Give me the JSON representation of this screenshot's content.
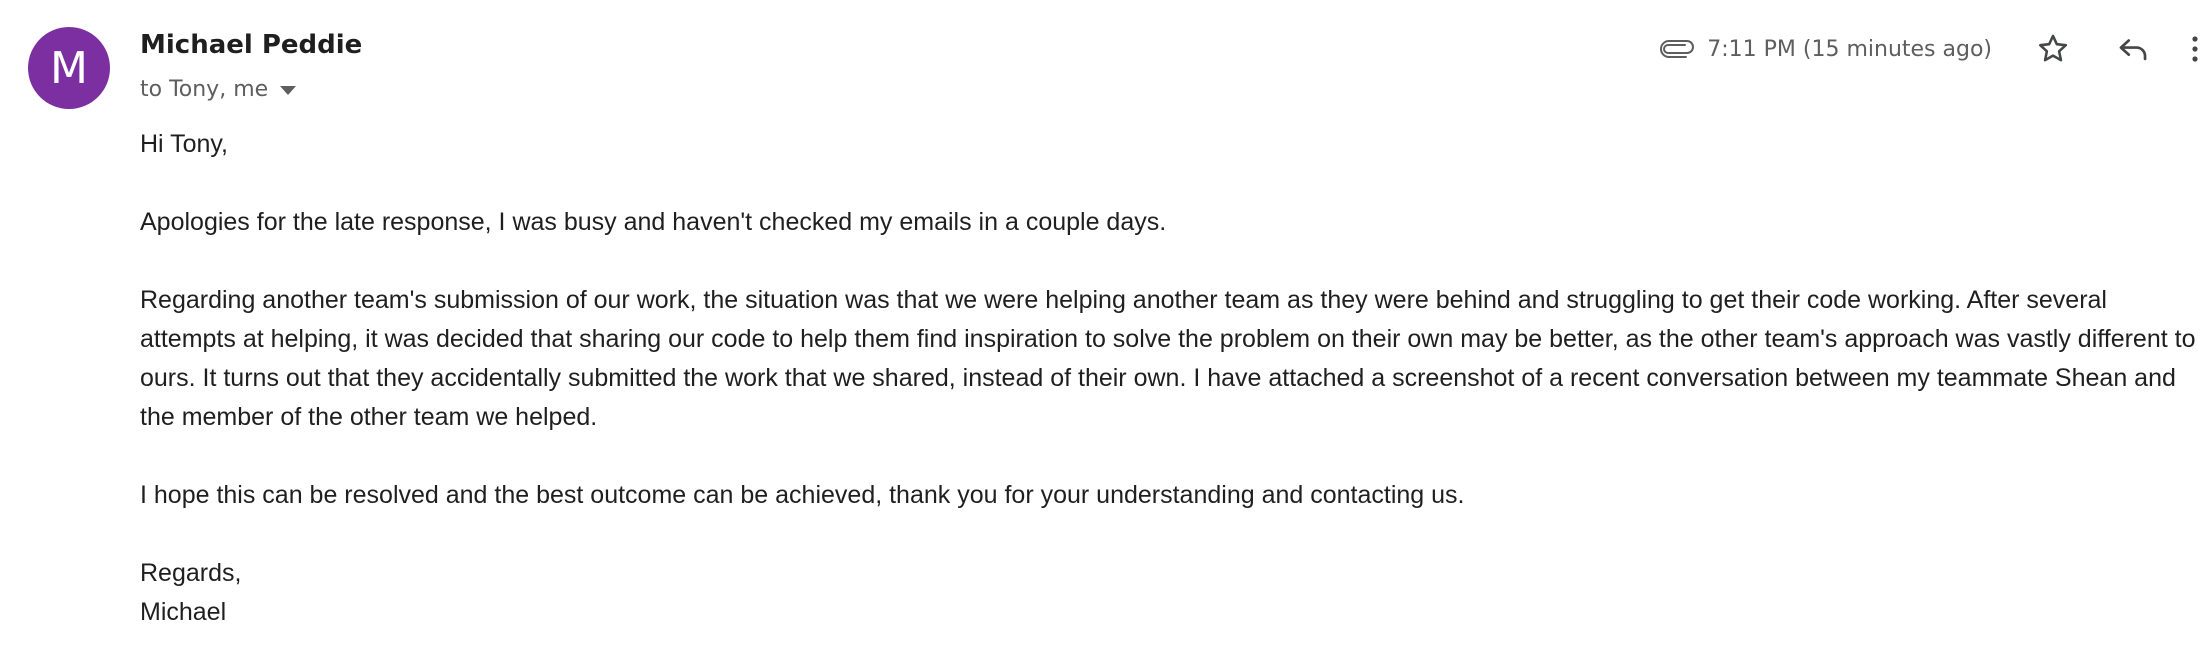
{
  "sender": {
    "initial": "M",
    "name": "Michael Peddie",
    "recipients": "to Tony, me",
    "avatar_color": "#7b2fa0"
  },
  "meta": {
    "timestamp": "7:11 PM (15 minutes ago)",
    "icons": [
      "paperclip-icon",
      "star-icon",
      "reply-icon",
      "more-vert-icon"
    ]
  },
  "body": {
    "greeting": "Hi Tony,",
    "para1": "Apologies for the late response, I was busy and haven't checked my emails in a couple days.",
    "para2": "Regarding another team's submission of our work, the situation was that we were helping another team as they were behind and struggling to get their code working. After several attempts at helping, it was decided that sharing our code to help them find inspiration to solve the problem on their own may be better, as the other team's approach was vastly different to ours. It turns out that they accidentally submitted the work that we shared, instead of their own. I have attached a screenshot of a recent conversation between my teammate Shean and the member of the other team we helped.",
    "para3": "I hope this can be resolved and the best outcome can be achieved, thank you for your understanding and contacting us.",
    "signoff": "Regards,",
    "signature": "Michael"
  }
}
